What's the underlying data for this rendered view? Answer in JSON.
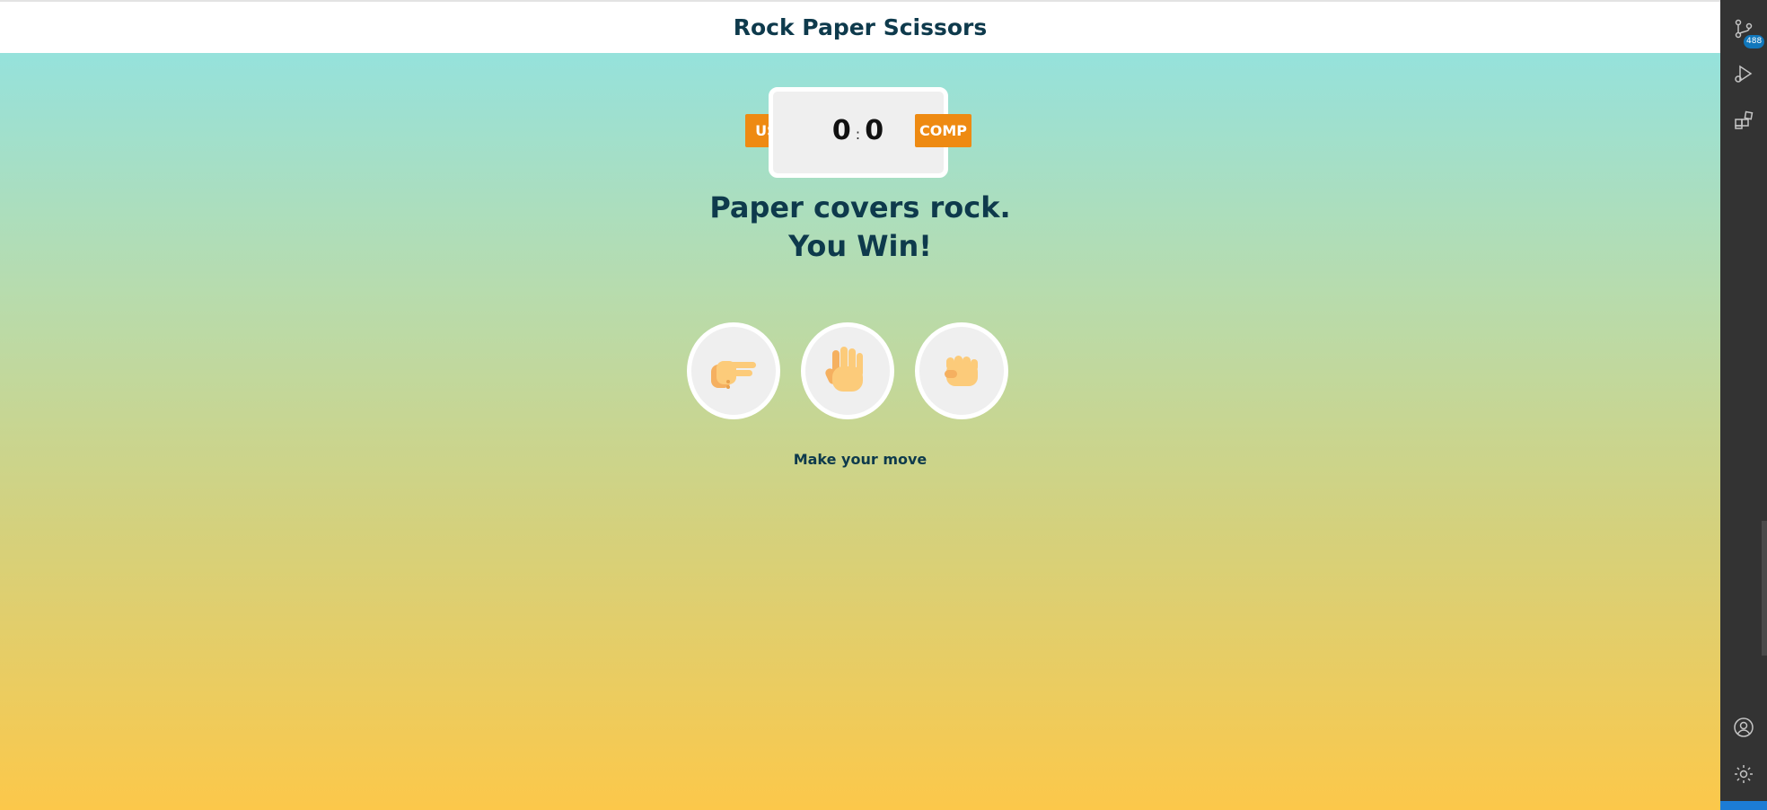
{
  "app": {
    "title": "Rock Paper Scissors"
  },
  "scoreboard": {
    "user_label": "USER",
    "comp_label": "COMP",
    "user_score": "0",
    "comp_score": "0",
    "separator": ":"
  },
  "result": {
    "line1": "Paper covers rock.",
    "line2": "You Win!"
  },
  "choices": [
    {
      "name": "scissors",
      "icon": "scissors-hand-icon"
    },
    {
      "name": "paper",
      "icon": "paper-hand-icon"
    },
    {
      "name": "rock",
      "icon": "rock-fist-icon"
    }
  ],
  "message": "Make your move",
  "activity_bar": {
    "source_control_count": "488",
    "items": [
      "source-control-icon",
      "run-debug-icon",
      "extensions-icon",
      "account-icon",
      "settings-gear-icon"
    ]
  },
  "colors": {
    "badge": "#ee8a12",
    "heading": "#0e3a4c",
    "gradient_top": "#8ee3e6",
    "gradient_bottom": "#fcc84a",
    "skin": "#fccb7a"
  }
}
